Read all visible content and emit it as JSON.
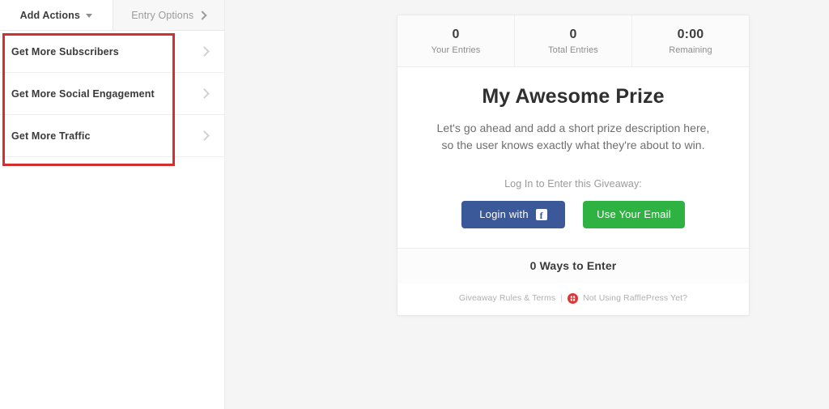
{
  "left_panel": {
    "tabs": [
      {
        "label": "Add Actions",
        "icon": "chevron-down-icon",
        "active": true
      },
      {
        "label": "Entry Options",
        "icon": "chevron-right-icon",
        "active": false
      }
    ],
    "actions": [
      {
        "label": "Get More Subscribers",
        "chevron": "chevron-right-icon"
      },
      {
        "label": "Get More Social Engagement",
        "chevron": "chevron-right-icon"
      },
      {
        "label": "Get More Traffic",
        "chevron": "chevron-right-icon"
      }
    ],
    "highlight_color": "#d32f2f"
  },
  "giveaway": {
    "stats": [
      {
        "value": "0",
        "label": "Your Entries"
      },
      {
        "value": "0",
        "label": "Total Entries"
      },
      {
        "value": "0:00",
        "label": "Remaining"
      }
    ],
    "title": "My Awesome Prize",
    "description_line1": "Let's go ahead and add a short prize description here,",
    "description_line2": "so the user knows exactly what they're about to win.",
    "login_prompt": "Log In to Enter this Giveaway:",
    "buttons": {
      "facebook": {
        "label": "Login with",
        "icon": "facebook-icon",
        "color": "#3b5998"
      },
      "email": {
        "label": "Use Your Email",
        "color": "#2eb342"
      }
    },
    "ways_to_enter": "0 Ways to Enter",
    "footer": {
      "rules_link": "Giveaway Rules & Terms",
      "separator": "|",
      "logo": "rafflepress-logo-icon",
      "promo_link": "Not Using RafflePress Yet?"
    }
  }
}
